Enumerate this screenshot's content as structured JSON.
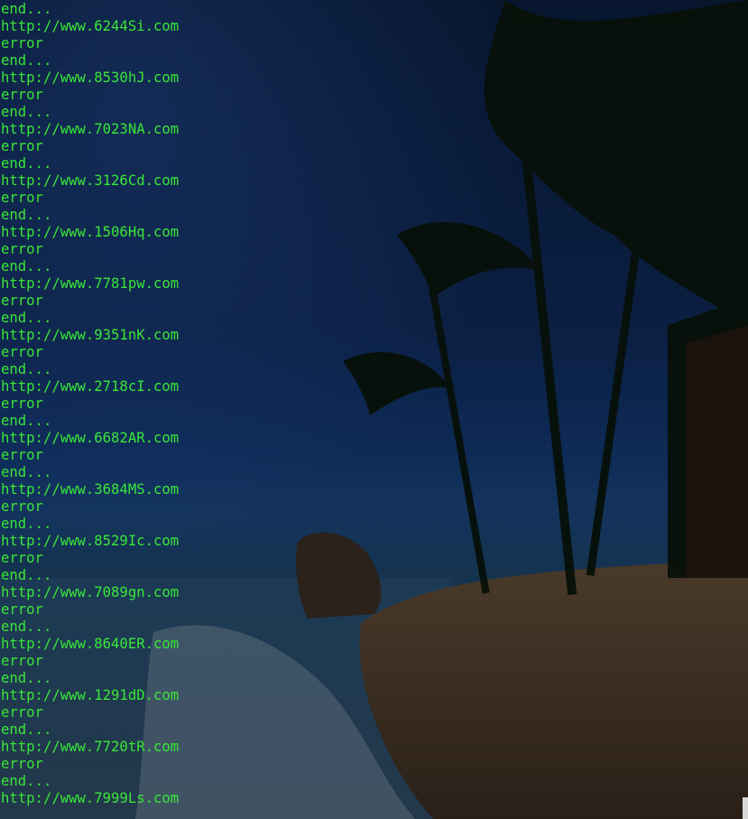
{
  "terminal": {
    "text_color": "#39e639",
    "lines": [
      "end...",
      "http://www.6244Si.com",
      "error",
      "end...",
      "http://www.8530hJ.com",
      "error",
      "end...",
      "http://www.7023NA.com",
      "error",
      "end...",
      "http://www.3126Cd.com",
      "error",
      "end...",
      "http://www.1506Hq.com",
      "error",
      "end...",
      "http://www.7781pw.com",
      "error",
      "end...",
      "http://www.9351nK.com",
      "error",
      "end...",
      "http://www.2718cI.com",
      "error",
      "end...",
      "http://www.6682AR.com",
      "error",
      "end...",
      "http://www.3684MS.com",
      "error",
      "end...",
      "http://www.8529Ic.com",
      "error",
      "end...",
      "http://www.7089gn.com",
      "error",
      "end...",
      "http://www.8640ER.com",
      "error",
      "end...",
      "http://www.1291dD.com",
      "error",
      "end...",
      "http://www.7720tR.com",
      "error",
      "end...",
      "http://www.7999Ls.com"
    ]
  }
}
